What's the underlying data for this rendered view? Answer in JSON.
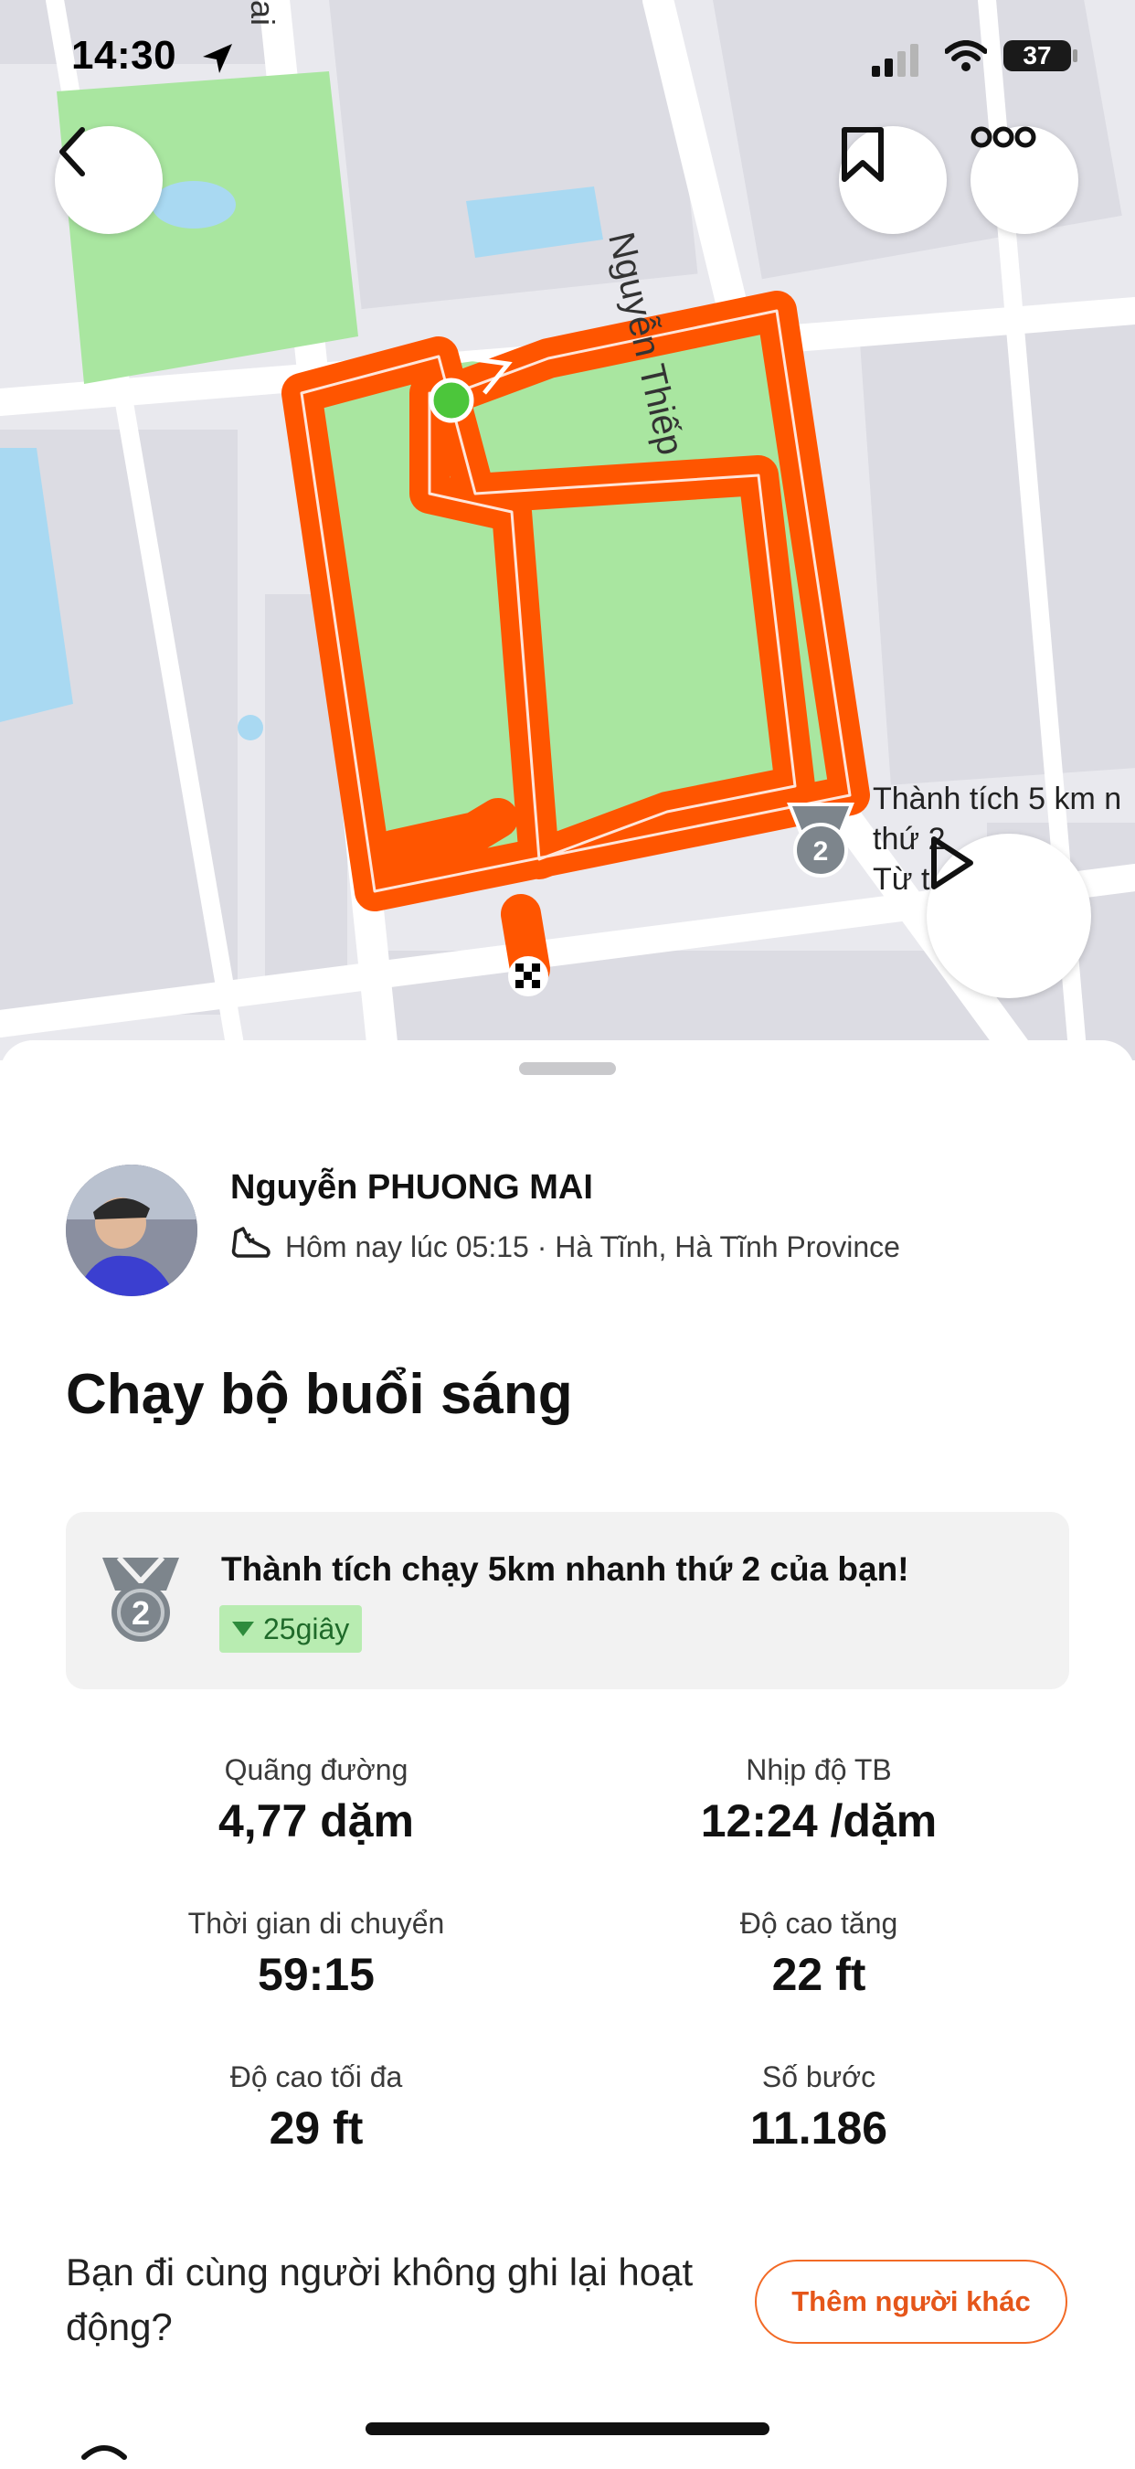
{
  "status_bar": {
    "time": "14:30",
    "battery": "37"
  },
  "map": {
    "street_nguyen": "Nguyễn Thiếp",
    "street_top": "ai",
    "achievement_callout": [
      "Thành tích 5 km n",
      "thứ 2",
      "Từ t          nay"
    ],
    "route_color": "#ff5500",
    "park_color": "#a9e6a0"
  },
  "icons": {
    "back": "chevron-left-icon",
    "bookmark": "bookmark-icon",
    "more": "more-icon",
    "play": "play-icon",
    "medal": "medal-icon",
    "shoe": "shoe-icon"
  },
  "athlete": {
    "name": "Nguyễn PHUONG MAI",
    "meta": "Hôm nay lúc 05:15 · Hà Tĩnh, Hà Tĩnh Province"
  },
  "activity": {
    "title": "Chạy bộ buổi sáng"
  },
  "achievement": {
    "text": "Thành tích chạy 5km nhanh thứ 2 của bạn!",
    "delta": "25giây",
    "rank": "2"
  },
  "stats": [
    {
      "label": "Quãng đường",
      "value": "4,77 dặm"
    },
    {
      "label": "Nhịp độ TB",
      "value": "12:24 /dặm"
    },
    {
      "label": "Thời gian di chuyển",
      "value": "59:15"
    },
    {
      "label": "Độ cao tăng",
      "value": "22 ft"
    },
    {
      "label": "Độ cao tối đa",
      "value": "29 ft"
    },
    {
      "label": "Số bước",
      "value": "11.186"
    }
  ],
  "cta": {
    "text": "Bạn đi cùng người không ghi lại hoạt động?",
    "button": "Thêm người khác"
  },
  "colors": {
    "accent": "#fc5200",
    "badge_bg": "#b8ecb1"
  }
}
